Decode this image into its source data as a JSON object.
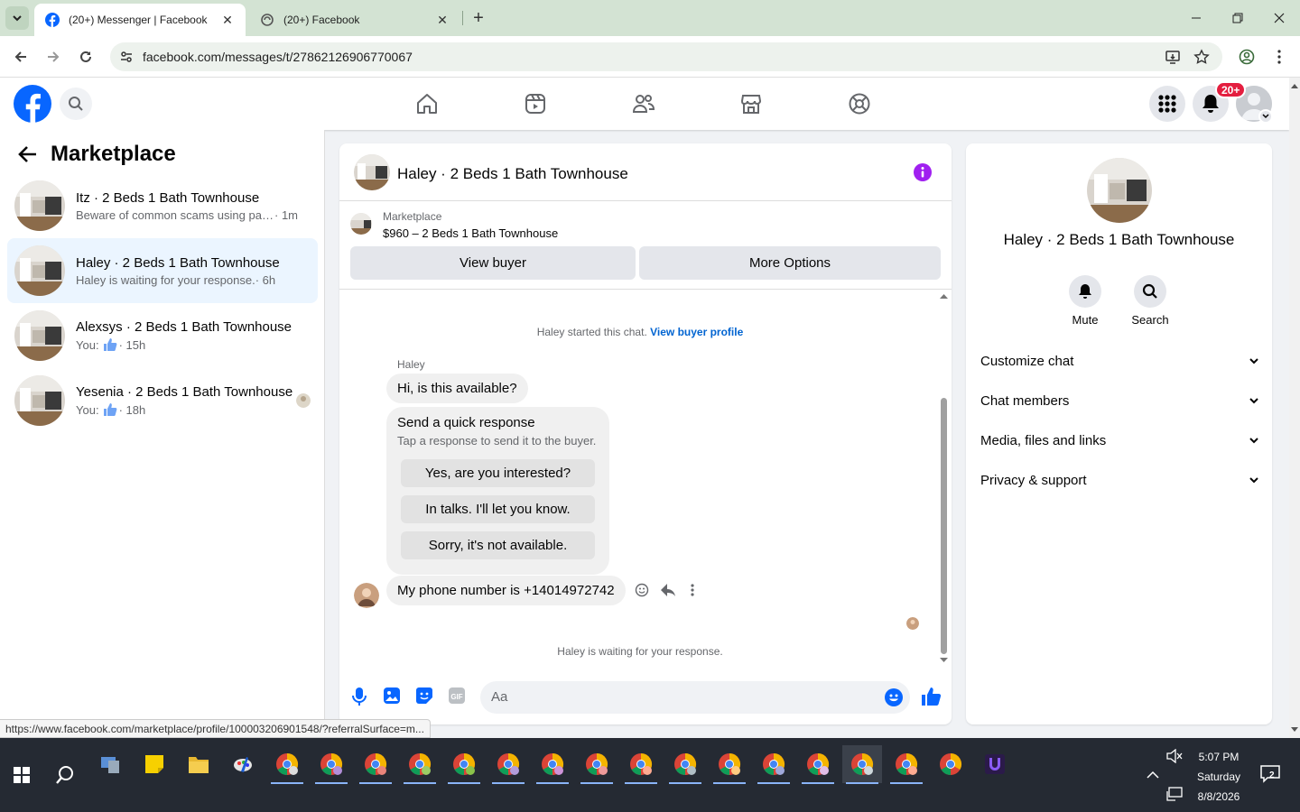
{
  "browser": {
    "tabs": [
      {
        "title": "(20+) Messenger | Facebook",
        "active": true
      },
      {
        "title": "(20+) Facebook",
        "active": false
      }
    ],
    "url": "facebook.com/messages/t/27862126906770067"
  },
  "header": {
    "notif_badge": "20+"
  },
  "sidebar": {
    "title": "Marketplace",
    "conversations": [
      {
        "name": "Itz · 2 Beds 1 Bath Townhouse",
        "preview": "Beware of common scams using pay...",
        "time": " · 1m",
        "selected": false
      },
      {
        "name": "Haley · 2 Beds 1 Bath Townhouse",
        "preview": "Haley is waiting for your response.",
        "time": " · 6h",
        "selected": true
      },
      {
        "name": "Alexsys · 2 Beds 1 Bath Townhouse",
        "preview": "You:",
        "time": " · 15h",
        "selected": false
      },
      {
        "name": "Yesenia · 2 Beds 1 Bath Townhouse",
        "preview": "You:",
        "time": " · 18h",
        "selected": false
      }
    ]
  },
  "chat": {
    "title": "Haley · 2 Beds 1 Bath Townhouse",
    "marketplace_label": "Marketplace",
    "listing": "$960 – 2 Beds 1 Bath Townhouse",
    "view_buyer": "View buyer",
    "more_options": "More Options",
    "started": "Haley started this chat.",
    "view_profile": "View buyer profile",
    "sender": "Haley",
    "first_msg": "Hi, is this available?",
    "quick_title": "Send a quick response",
    "quick_sub": "Tap a response to send it to the buyer.",
    "quick_replies": [
      "Yes, are you interested?",
      "In talks. I'll let you know.",
      "Sorry, it's not available."
    ],
    "phone_msg": "My phone number is +14014972742",
    "waiting": "Haley is waiting for your response.",
    "placeholder": "Aa"
  },
  "details": {
    "name": "Haley · 2 Beds 1 Bath Townhouse",
    "mute": "Mute",
    "search": "Search",
    "sections": [
      "Customize chat",
      "Chat members",
      "Media, files and links",
      "Privacy & support"
    ]
  },
  "status_url": "https://www.facebook.com/marketplace/profile/100003206901548/?referralSurface=m...",
  "taskbar": {
    "time": "5:07 PM",
    "day": "Saturday",
    "date": "8/8/2026",
    "notif_count": "2"
  },
  "colors": {
    "fb_blue": "#0866ff",
    "badge_red": "#e41e3f",
    "purple_info": "#a020f0",
    "chrome_green": "#d3e3d3"
  }
}
